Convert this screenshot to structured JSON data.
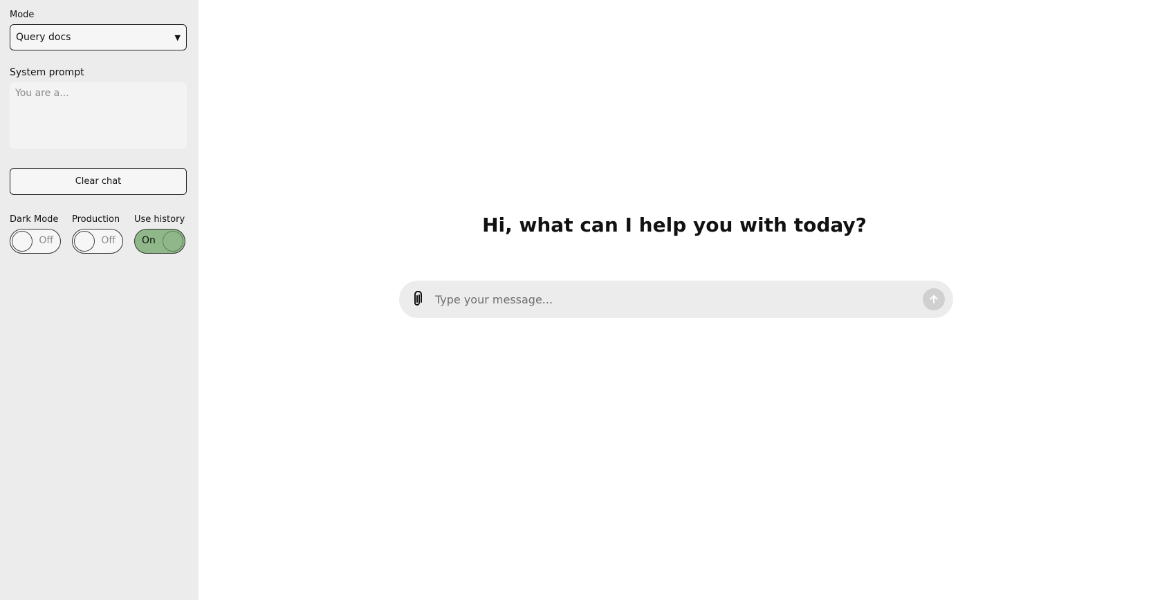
{
  "sidebar": {
    "mode_label": "Mode",
    "mode_value": "Query docs",
    "system_prompt_label": "System prompt",
    "system_prompt_placeholder": "You are a...",
    "clear_chat_label": "Clear chat",
    "toggles": [
      {
        "label": "Dark Mode",
        "state": "Off"
      },
      {
        "label": "Production",
        "state": "Off"
      },
      {
        "label": "Use history",
        "state": "On"
      }
    ]
  },
  "main": {
    "heading": "Hi, what can I help you with today?",
    "message_placeholder": "Type your message...",
    "attach_icon": "paperclip-icon",
    "send_icon": "arrow-up-icon"
  },
  "colors": {
    "sidebar_bg": "#ececec",
    "toggle_on": "#8fb78a",
    "composer_bg": "#ececec"
  }
}
